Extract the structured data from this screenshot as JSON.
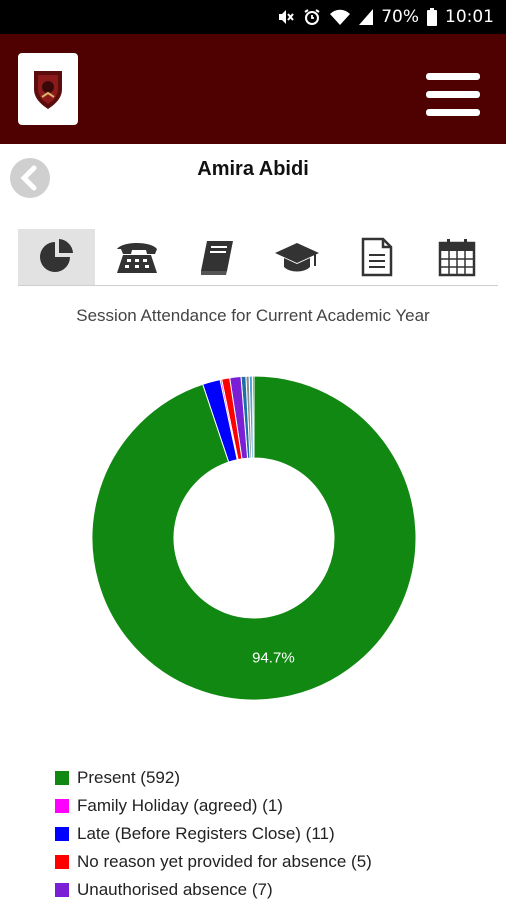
{
  "status_bar": {
    "battery": "70%",
    "time": "10:01",
    "icons": [
      "mute-icon",
      "alarm-icon",
      "wifi-icon",
      "signal-icon",
      "battery-icon"
    ]
  },
  "header": {
    "logo": "school-crest-logo",
    "menu_icon": "hamburger-menu-icon",
    "background": "#4f0000"
  },
  "nav": {
    "back_icon": "back-arrow-icon"
  },
  "student": {
    "name": "Amira Abidi"
  },
  "tabs": [
    {
      "icon": "pie-chart-icon",
      "active": true
    },
    {
      "icon": "telephone-icon",
      "active": false
    },
    {
      "icon": "book-icon",
      "active": false
    },
    {
      "icon": "graduation-cap-icon",
      "active": false
    },
    {
      "icon": "document-icon",
      "active": false
    },
    {
      "icon": "calendar-icon",
      "active": false
    }
  ],
  "chart_data": {
    "type": "pie",
    "title": "Session Attendance for Current Academic Year",
    "donut": true,
    "slice_label": "94.7%",
    "series": [
      {
        "name": "Present (592)",
        "value": 592,
        "color": "#118811"
      },
      {
        "name": "Family Holiday (agreed) (1)",
        "value": 1,
        "color": "#ff00ff"
      },
      {
        "name": "Late (Before Registers Close) (11)",
        "value": 11,
        "color": "#0000ff"
      },
      {
        "name": "No reason yet provided for absence (5)",
        "value": 5,
        "color": "#ff0000"
      },
      {
        "name": "Unauthorised absence (7)",
        "value": 7,
        "color": "#7a1fd6"
      }
    ],
    "unlabeled_slices": [
      {
        "value": 3,
        "color": "#1e6fa8"
      },
      {
        "value": 2,
        "color": "#8c8c8c"
      },
      {
        "value": 2,
        "color": "#4aa3d9"
      },
      {
        "value": 1,
        "color": "#2e5a7a"
      }
    ]
  }
}
